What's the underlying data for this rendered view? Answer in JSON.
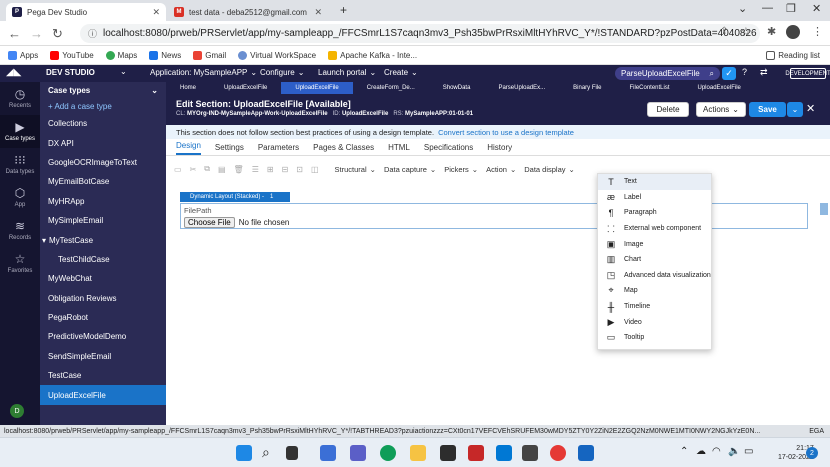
{
  "browser": {
    "tabs": [
      {
        "label": "Pega Dev Studio",
        "favicon": "pega-icon"
      },
      {
        "label": "test data - deba2512@gmail.com",
        "favicon": "gmail-icon"
      }
    ],
    "new_tab": "+",
    "url": "localhost:8080/prweb/PRServlet/app/my-sampleapp_/FFCSmrL1S7caqn3mv3_Psh35bwPrRsxiMltHYhRVC_Y*/!STANDARD?pzPostData=4040826",
    "bookmarks": [
      "Apps",
      "YouTube",
      "Maps",
      "News",
      "Gmail",
      "Virtual WorkSpace",
      "Apache Kafka - Inte..."
    ],
    "reading_list": "Reading list"
  },
  "pega_header": {
    "studio": "DEV STUDIO",
    "application": "Application: MySampleAPP",
    "menus": [
      "Configure",
      "Launch portal",
      "Create"
    ],
    "search_value": "ParseUploadExcelFile",
    "badge": "DEVELOPMENT"
  },
  "left_nav": [
    {
      "label": "Recents",
      "icon": "clock-icon"
    },
    {
      "label": "Case types",
      "icon": "case-types-icon"
    },
    {
      "label": "Data types",
      "icon": "data-types-icon"
    },
    {
      "label": "App",
      "icon": "app-icon"
    },
    {
      "label": "Records",
      "icon": "records-icon"
    },
    {
      "label": "Favorites",
      "icon": "star-icon"
    }
  ],
  "case_types": {
    "header": "Case types",
    "add": "+ Add a case type",
    "items": [
      "Collections",
      "DX API",
      "GoogleOCRImageToText",
      "MyEmailBotCase",
      "MyHRApp",
      "MySimpleEmail",
      "MyTestCase",
      "TestChildCase",
      "MyWebChat",
      "Obligation Reviews",
      "PegaRobot",
      "PredictiveModelDemo",
      "SendSimpleEmail",
      "TestCase",
      "UploadExcelFile"
    ]
  },
  "workspace": {
    "tabs": [
      "Home",
      "UploadExcelFile",
      "UploadExcelFile",
      "CreateForm_De...",
      "ShowData",
      "ParseUploadEx...",
      "Binary File",
      "FileContentList",
      "UploadExcelFile"
    ],
    "title": "Edit  Section: UploadExcelFile [Available]",
    "cl_label": "CL:",
    "cl_value": "MYOrg-IND-MySampleApp-Work-UploadExcelFile",
    "id_label": "ID:",
    "id_value": "UploadExcelFile",
    "rs_label": "RS:",
    "rs_value": "MySampleAPP:01-01-01",
    "delete": "Delete",
    "actions": "Actions",
    "save": "Save",
    "notice": "This section does not follow section best practices of using a design template.",
    "notice_link": "Convert section to use a design template",
    "section_tabs": [
      "Design",
      "Settings",
      "Parameters",
      "Pages & Classes",
      "HTML",
      "Specifications",
      "History"
    ],
    "toolbar_menus": [
      "Structural",
      "Data capture",
      "Pickers",
      "Action",
      "Data display"
    ],
    "layout_label": "Dynamic Layout (Stacked) -",
    "layout_num": "1",
    "field_label": "FilePath",
    "choose_file": "Choose File",
    "no_file": "No file chosen"
  },
  "data_display_menu": [
    {
      "label": "Text",
      "icon": "text-icon"
    },
    {
      "label": "Label",
      "icon": "label-icon"
    },
    {
      "label": "Paragraph",
      "icon": "paragraph-icon"
    },
    {
      "label": "External web component",
      "icon": "external-component-icon"
    },
    {
      "label": "Image",
      "icon": "image-icon"
    },
    {
      "label": "Chart",
      "icon": "chart-icon"
    },
    {
      "label": "Advanced data visualization",
      "icon": "advanced-viz-icon"
    },
    {
      "label": "Map",
      "icon": "map-icon"
    },
    {
      "label": "Timeline",
      "icon": "timeline-icon"
    },
    {
      "label": "Video",
      "icon": "video-icon"
    },
    {
      "label": "Tooltip",
      "icon": "tooltip-icon"
    }
  ],
  "status_url": "localhost:8080/prweb/PRServlet/app/my-sampleapp_/FFCSmrL1S7caqn3mv3_Psh35bwPrRsxiMltHYhRVC_Y*/!TABTHREAD3?pzuiactionzzz=CXt0cn17VEFCVEhSRUFEM30wMDY5ZTY0Y2ZiN2E2ZGQ2NzM0NWE1MTI0NWY2NGJkYzE0N...",
  "status_right": "EGA",
  "taskbar": {
    "time": "21:17",
    "date": "17-02-2022",
    "notifications": "2"
  },
  "colors": {
    "pega_dark": "#1f1f47",
    "accent": "#1a73c8",
    "save": "#1e88e5"
  }
}
